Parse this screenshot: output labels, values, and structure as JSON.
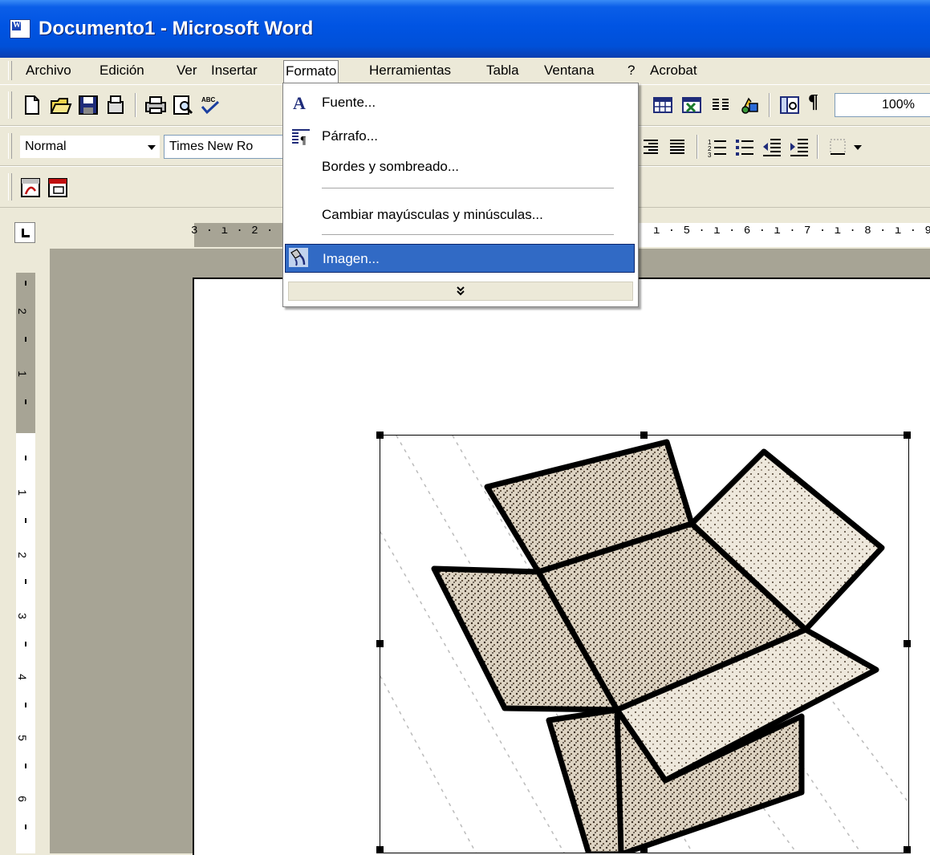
{
  "window": {
    "title": "Documento1 - Microsoft Word"
  },
  "menubar": {
    "items": [
      "Archivo",
      "Edición",
      "Ver",
      "Insertar",
      "Formato",
      "Herramientas",
      "Tabla",
      "Ventana",
      "?",
      "Acrobat"
    ],
    "open_menu": "Formato"
  },
  "standard_toolbar": {
    "zoom": "100%"
  },
  "format_toolbar": {
    "style": "Normal",
    "font": "Times New Ro"
  },
  "format_menu": {
    "items": [
      {
        "label": "Fuente...",
        "icon": "font-A-icon"
      },
      {
        "label": "Párrafo...",
        "icon": "paragraph-icon"
      },
      {
        "label": "Bordes y sombreado...",
        "icon": ""
      },
      {
        "label": "Cambiar mayúsculas y minúsculas...",
        "icon": ""
      },
      {
        "label": "Imagen...",
        "icon": "format-picture-icon",
        "highlighted": true
      }
    ],
    "expand_glyph": "¯"
  },
  "ruler": {
    "h_left_text": "3 · ı · 2 ·",
    "h_right_text": "ı · 5 · ı · 6 · ı · 7 · ı · 8 · ı · 9",
    "v_numbers": [
      "2",
      "1",
      "1",
      "2",
      "3",
      "4",
      "5",
      "6"
    ]
  },
  "colors": {
    "title_blue": "#0054e3",
    "menu_highlight": "#316ac5",
    "toolbar_bg": "#ece9d8",
    "workspace_gray": "#a7a495"
  }
}
